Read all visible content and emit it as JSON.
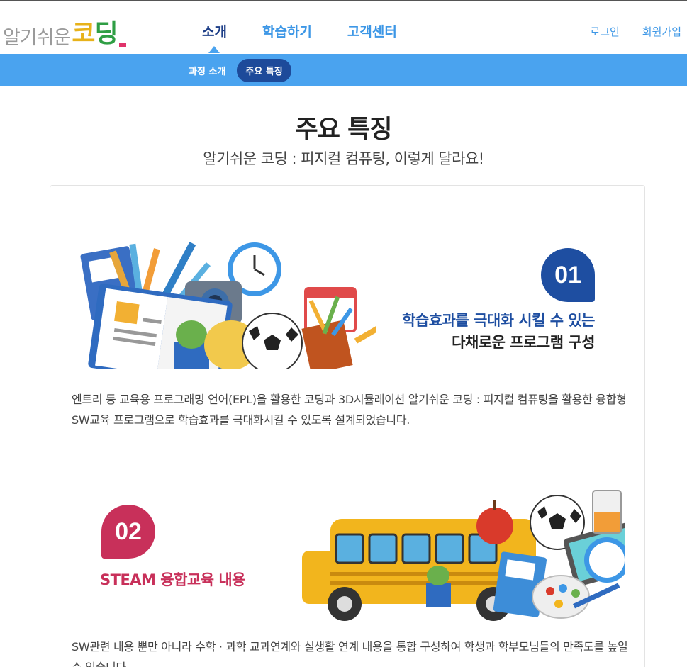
{
  "logo": {
    "part1": "알기쉬운",
    "part2a": "코",
    "part2b": "딩"
  },
  "nav": [
    {
      "label": "소개",
      "active": true
    },
    {
      "label": "학습하기",
      "active": false
    },
    {
      "label": "고객센터",
      "active": false
    }
  ],
  "util": {
    "login": "로그인",
    "signup": "회원가입"
  },
  "subnav": [
    {
      "label": "과정 소개",
      "active": false
    },
    {
      "label": "주요 특징",
      "active": true
    }
  ],
  "page": {
    "title": "주요 특징",
    "subtitle": "알기쉬운 코딩 : 피지컬 컴퓨팅, 이렇게 달라요!"
  },
  "features": [
    {
      "number": "01",
      "line1": "학습효과를 극대화 시킬 수 있는",
      "line2": "다채로운 프로그램 구성",
      "description": "엔트리 등 교육용 프로그래밍 언어(EPL)을 활용한 코딩과 3D시뮬레이션 알기쉬운 코딩 : 피지컬 컴퓨팅을 활용한 융합형 SW교육 프로그램으로 학습효과를 극대화시킬 수 있도록 설계되었습니다."
    },
    {
      "number": "02",
      "line1": "STEAM 융합교육 내용",
      "description": "SW관련 내용 뿐만 아니라 수학 · 과학 교과연계와 실생활 연계 내용을 통합 구성하여 학생과 학부모님들의 만족도를 높일 수 있습니다."
    }
  ],
  "colors": {
    "primary": "#4aa3ef",
    "navy": "#1e4ea1",
    "accent_red": "#c8305a"
  }
}
